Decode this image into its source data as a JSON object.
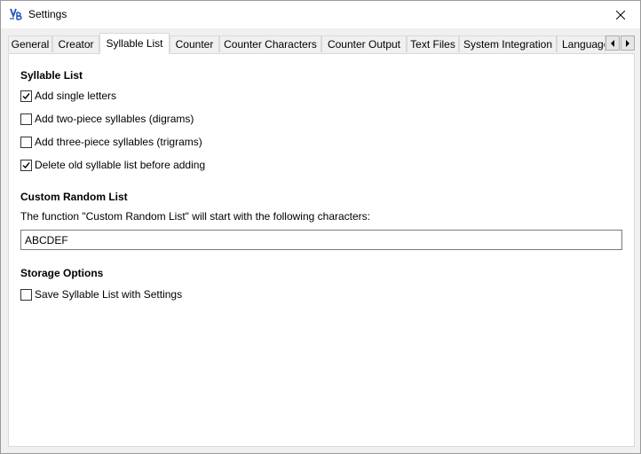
{
  "window": {
    "title": "Settings",
    "app_icon": "syllable-app-icon",
    "close_icon": "close-icon"
  },
  "tabs": [
    {
      "label": "General",
      "selected": false
    },
    {
      "label": "Creator",
      "selected": false
    },
    {
      "label": "Syllable List",
      "selected": true
    },
    {
      "label": "Counter",
      "selected": false
    },
    {
      "label": "Counter Characters",
      "selected": false
    },
    {
      "label": "Counter Output",
      "selected": false
    },
    {
      "label": "Text Files",
      "selected": false
    },
    {
      "label": "System Integration",
      "selected": false
    },
    {
      "label": "Language",
      "selected": false
    }
  ],
  "tab_scroll": {
    "left_icon": "arrow-left-icon",
    "right_icon": "arrow-right-icon"
  },
  "syllable_list": {
    "heading": "Syllable List",
    "options": [
      {
        "label": "Add single letters",
        "checked": true
      },
      {
        "label": "Add two-piece syllables (digrams)",
        "checked": false
      },
      {
        "label": "Add three-piece syllables (trigrams)",
        "checked": false
      },
      {
        "label": "Delete old syllable list before adding",
        "checked": true
      }
    ]
  },
  "custom_random_list": {
    "heading": "Custom Random List",
    "description": "The function \"Custom Random List\" will start with the following characters:",
    "value": "ABCDEF"
  },
  "storage_options": {
    "heading": "Storage Options",
    "options": [
      {
        "label": "Save Syllable List with Settings",
        "checked": false
      }
    ]
  },
  "colors": {
    "window_background": "#f0f0f0",
    "page_background": "#ffffff",
    "border": "#d9d9d9",
    "app_icon_blue": "#2a52be"
  }
}
